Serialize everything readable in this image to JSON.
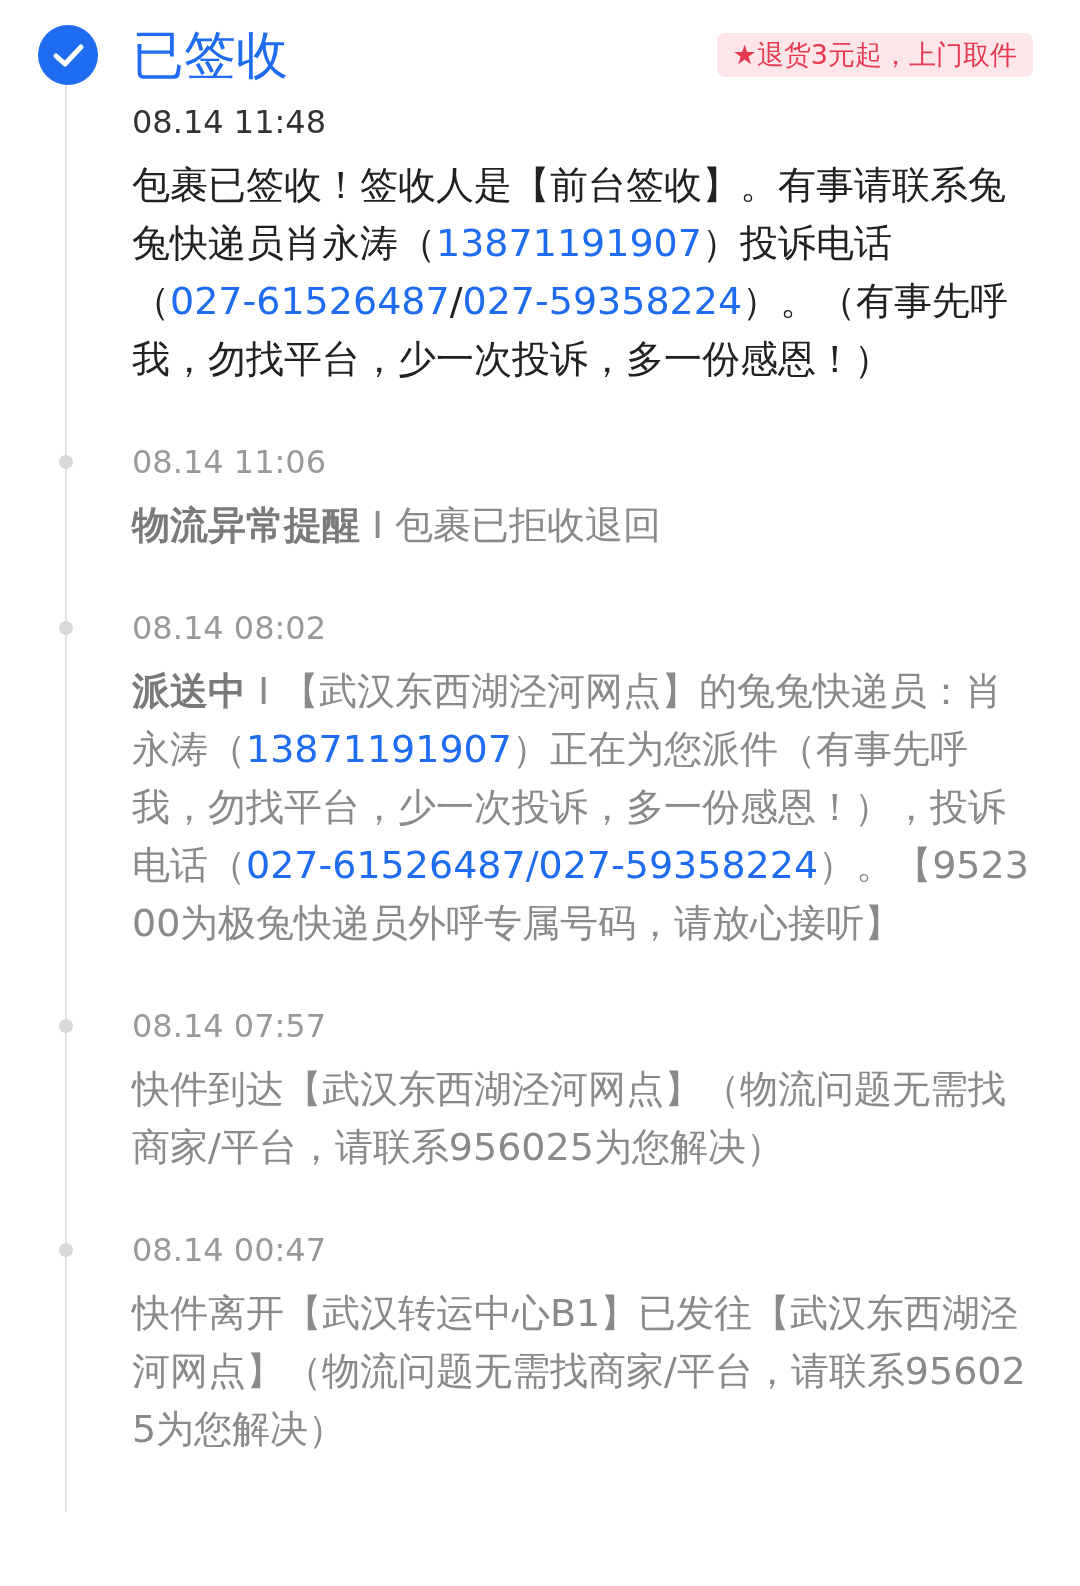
{
  "events": [
    {
      "current": true,
      "status": "已签收",
      "badge": "★退货3元起，上门取件",
      "time": "08.14 11:48",
      "parts": [
        {
          "kind": "text",
          "text": "包裹已签收！签收人是【前台签收】。有事请联系兔兔快递员肖永涛（"
        },
        {
          "kind": "link",
          "text": "13871191907"
        },
        {
          "kind": "text",
          "text": "）投诉电话（"
        },
        {
          "kind": "link",
          "text": "027-61526487"
        },
        {
          "kind": "text",
          "text": "/"
        },
        {
          "kind": "link",
          "text": "027-59358224"
        },
        {
          "kind": "text",
          "text": "）。（有事先呼我，勿找平台，少一次投诉，多一份感恩！）"
        }
      ]
    },
    {
      "current": false,
      "time": "08.14 11:06",
      "parts": [
        {
          "kind": "title",
          "text": "物流异常提醒"
        },
        {
          "kind": "text",
          "text": " I 包裹已拒收退回"
        }
      ]
    },
    {
      "current": false,
      "time": "08.14 08:02",
      "parts": [
        {
          "kind": "title",
          "text": "派送中"
        },
        {
          "kind": "text",
          "text": " I 【武汉东西湖泾河网点】的兔兔快递员：肖永涛（"
        },
        {
          "kind": "link",
          "text": "13871191907"
        },
        {
          "kind": "text",
          "text": "）正在为您派件（有事先呼我，勿找平台，少一次投诉，多一份感恩！），投诉电话（"
        },
        {
          "kind": "link",
          "text": "027-61526487/027-59358224"
        },
        {
          "kind": "text",
          "text": "）。【952300为极兔快递员外呼专属号码，请放心接听】"
        }
      ]
    },
    {
      "current": false,
      "time": "08.14 07:57",
      "parts": [
        {
          "kind": "text",
          "text": "快件到达【武汉东西湖泾河网点】（物流问题无需找商家/平台，请联系956025为您解决）"
        }
      ]
    },
    {
      "current": false,
      "time": "08.14 00:47",
      "parts": [
        {
          "kind": "text",
          "text": "快件离开【武汉转运中心B1】已发往【武汉东西湖泾河网点】（物流问题无需找商家/平台，请联系956025为您解决）"
        }
      ]
    }
  ]
}
